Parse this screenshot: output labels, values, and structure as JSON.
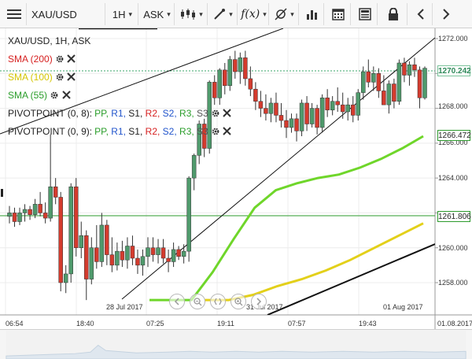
{
  "toolbar": {
    "symbol": "XAU/USD",
    "timeframe": "1H",
    "price_type": "ASK",
    "icons": [
      "menu-icon",
      "candles-icon",
      "draw-line-icon",
      "fx-icon",
      "crosshair-icon",
      "bar-chart-icon",
      "calendar-icon",
      "table-icon",
      "lock-icon",
      "chevron-left-icon",
      "chevron-right-icon"
    ]
  },
  "legend": {
    "title": "XAU/USD, 1H, ASK",
    "sma200": "SMA (200)",
    "sma100": "SMA (100)",
    "sma55": "SMA (55)",
    "pivot1_name": "PIVOTPOINT (0, 8):",
    "pivot2_name": "PIVOTPOINT (0, 9):",
    "pivot_levels": [
      "PP,",
      "R1,",
      "S1,",
      "R2,",
      "S2,",
      "R3,",
      "S3"
    ],
    "pivot_colors": [
      "#2a9d2a",
      "#2255cc",
      "#222222",
      "#d62020",
      "#2255cc",
      "#2a9d2a",
      "#555555"
    ],
    "sma_colors": {
      "sma200": "#d62020",
      "sma100": "#d4c500",
      "sma55": "#2a9d2a"
    }
  },
  "price_axis": {
    "ticks": [
      "1272.000",
      "1270.000",
      "1268.000",
      "1266.000",
      "1264.000",
      "1262.000",
      "1260.000",
      "1258.000"
    ],
    "last_price": "1270.242",
    "sma55_value": "1266.472",
    "sma100_value": "1261.806"
  },
  "time_axis": {
    "ticks": [
      "06:54",
      "18:40",
      "07:25",
      "19:11",
      "07:57",
      "19:43",
      "01.08.2017"
    ],
    "date_labels": [
      "28 Jul 2017",
      "31 Jul 2017",
      "01 Aug 2017"
    ]
  },
  "chart_data": {
    "type": "candlestick",
    "ylim": [
      1257.0,
      1273.0
    ],
    "candles": [
      [
        1261.8,
        1262.4,
        1261.4,
        1262.0
      ],
      [
        1262.0,
        1262.3,
        1261.2,
        1261.5
      ],
      [
        1261.5,
        1262.3,
        1261.3,
        1262.0
      ],
      [
        1262.0,
        1262.5,
        1261.5,
        1262.2
      ],
      [
        1262.2,
        1262.4,
        1261.6,
        1261.9
      ],
      [
        1261.9,
        1262.8,
        1261.7,
        1262.5
      ],
      [
        1262.5,
        1263.2,
        1261.8,
        1262.0
      ],
      [
        1262.0,
        1262.6,
        1261.4,
        1261.7
      ],
      [
        1261.7,
        1266.5,
        1261.5,
        1263.5
      ],
      [
        1263.5,
        1264.0,
        1262.5,
        1262.9
      ],
      [
        1262.9,
        1263.2,
        1257.5,
        1258.0
      ],
      [
        1258.0,
        1259.0,
        1257.4,
        1258.5
      ],
      [
        1258.5,
        1263.7,
        1258.0,
        1263.5
      ],
      [
        1263.5,
        1264.0,
        1259.5,
        1260.0
      ],
      [
        1260.0,
        1261.5,
        1259.4,
        1260.7
      ],
      [
        1260.7,
        1261.0,
        1257.0,
        1258.2
      ],
      [
        1258.2,
        1260.6,
        1257.9,
        1260.0
      ],
      [
        1260.0,
        1261.3,
        1258.8,
        1259.2
      ],
      [
        1259.2,
        1262.0,
        1258.9,
        1261.3
      ],
      [
        1261.3,
        1261.6,
        1259.0,
        1259.6
      ],
      [
        1259.6,
        1260.6,
        1258.6,
        1259.0
      ],
      [
        1259.0,
        1260.3,
        1258.7,
        1259.8
      ],
      [
        1259.8,
        1260.4,
        1258.9,
        1259.3
      ],
      [
        1259.3,
        1260.6,
        1258.8,
        1260.1
      ],
      [
        1260.1,
        1260.7,
        1259.0,
        1259.4
      ],
      [
        1259.4,
        1259.9,
        1258.5,
        1259.0
      ],
      [
        1259.0,
        1259.9,
        1258.4,
        1259.5
      ],
      [
        1259.5,
        1260.6,
        1258.9,
        1260.0
      ],
      [
        1260.0,
        1260.6,
        1259.2,
        1259.6
      ],
      [
        1259.6,
        1260.5,
        1259.1,
        1260.0
      ],
      [
        1260.0,
        1260.5,
        1259.1,
        1259.4
      ],
      [
        1259.4,
        1259.9,
        1258.6,
        1259.2
      ],
      [
        1259.2,
        1260.3,
        1258.9,
        1259.9
      ],
      [
        1259.9,
        1260.1,
        1259.3,
        1259.5
      ],
      [
        1259.5,
        1260.2,
        1259.1,
        1259.8
      ],
      [
        1259.8,
        1264.1,
        1259.2,
        1264.0
      ],
      [
        1264.0,
        1265.4,
        1263.3,
        1265.3
      ],
      [
        1265.3,
        1267.3,
        1264.8,
        1267.1
      ],
      [
        1267.1,
        1267.4,
        1265.2,
        1265.7
      ],
      [
        1265.7,
        1269.6,
        1265.4,
        1269.5
      ],
      [
        1269.5,
        1269.9,
        1268.2,
        1268.6
      ],
      [
        1268.6,
        1270.3,
        1268.2,
        1270.2
      ],
      [
        1270.2,
        1270.6,
        1268.8,
        1269.3
      ],
      [
        1269.3,
        1271.0,
        1269.0,
        1270.8
      ],
      [
        1270.8,
        1271.3,
        1269.7,
        1270.1
      ],
      [
        1270.1,
        1271.2,
        1269.4,
        1270.9
      ],
      [
        1270.9,
        1271.3,
        1269.3,
        1269.7
      ],
      [
        1269.7,
        1270.4,
        1268.7,
        1269.1
      ],
      [
        1269.1,
        1269.5,
        1267.9,
        1268.4
      ],
      [
        1268.4,
        1269.0,
        1267.5,
        1268.0
      ],
      [
        1268.0,
        1268.8,
        1267.3,
        1267.7
      ],
      [
        1267.7,
        1268.6,
        1267.2,
        1268.3
      ],
      [
        1268.3,
        1268.9,
        1267.2,
        1267.6
      ],
      [
        1267.6,
        1268.3,
        1266.9,
        1267.3
      ],
      [
        1267.3,
        1267.9,
        1266.3,
        1266.9
      ],
      [
        1266.9,
        1267.7,
        1266.6,
        1267.4
      ],
      [
        1267.4,
        1267.7,
        1266.1,
        1266.7
      ],
      [
        1266.7,
        1268.5,
        1266.4,
        1268.3
      ],
      [
        1268.3,
        1268.7,
        1266.7,
        1267.1
      ],
      [
        1267.1,
        1268.3,
        1266.9,
        1268.0
      ],
      [
        1268.0,
        1268.2,
        1266.5,
        1266.9
      ],
      [
        1266.9,
        1268.8,
        1266.6,
        1268.6
      ],
      [
        1268.6,
        1269.1,
        1267.5,
        1267.9
      ],
      [
        1267.9,
        1268.7,
        1267.6,
        1268.4
      ],
      [
        1268.4,
        1269.2,
        1267.8,
        1268.2
      ],
      [
        1268.2,
        1268.9,
        1267.4,
        1267.8
      ],
      [
        1267.8,
        1268.6,
        1267.3,
        1268.2
      ],
      [
        1268.2,
        1268.7,
        1267.2,
        1267.6
      ],
      [
        1267.6,
        1269.1,
        1267.3,
        1268.9
      ],
      [
        1268.9,
        1270.4,
        1268.5,
        1270.1
      ],
      [
        1270.1,
        1270.8,
        1269.2,
        1269.5
      ],
      [
        1269.5,
        1270.4,
        1269.0,
        1270.0
      ],
      [
        1270.0,
        1270.3,
        1268.6,
        1269.0
      ],
      [
        1269.0,
        1269.9,
        1268.5,
        1268.2
      ],
      [
        1268.2,
        1269.6,
        1267.7,
        1269.4
      ],
      [
        1269.4,
        1269.7,
        1268.0,
        1268.4
      ],
      [
        1268.4,
        1270.8,
        1268.2,
        1270.6
      ],
      [
        1270.6,
        1270.9,
        1269.5,
        1269.9
      ],
      [
        1269.9,
        1270.7,
        1269.3,
        1270.5
      ],
      [
        1270.5,
        1270.9,
        1269.8,
        1270.2
      ],
      [
        1270.2,
        1270.4,
        1268.0,
        1268.6
      ],
      [
        1268.6,
        1270.4,
        1268.5,
        1270.3
      ]
    ],
    "sma55_line": [
      [
        1257.0,
        1257.0
      ],
      [
        1257.6,
        1257.0
      ],
      [
        1258.3,
        1257.0
      ],
      [
        1259.2,
        1258.6
      ],
      [
        1260.2,
        1260.5
      ],
      [
        1261.3,
        1262.3
      ],
      [
        1262.0,
        1263.3
      ],
      [
        1262.6,
        1263.7
      ],
      [
        1263.2,
        1264.0
      ],
      [
        1263.8,
        1264.2
      ],
      [
        1264.3,
        1264.6
      ],
      [
        1264.9,
        1265.1
      ],
      [
        1265.5,
        1265.7
      ],
      [
        1266.1,
        1266.4
      ]
    ],
    "sma100_line": [
      [
        1257.0,
        1257.0
      ],
      [
        1257.5,
        1257.0
      ],
      [
        1258.0,
        1257.3
      ],
      [
        1258.5,
        1257.8
      ],
      [
        1259.0,
        1258.2
      ],
      [
        1259.5,
        1258.7
      ],
      [
        1260.0,
        1259.3
      ],
      [
        1260.5,
        1260.0
      ],
      [
        1261.0,
        1260.7
      ],
      [
        1261.5,
        1261.4
      ]
    ],
    "channel_lines": [
      "1258.2 to 1273.0 rising lower channel",
      "1266.2 to 1273.0 rising upper channel",
      "1257.0 to 1260.1 bottom black line"
    ],
    "horizontal_lines": {
      "last_price": 1270.242,
      "green": 1261.806
    }
  }
}
